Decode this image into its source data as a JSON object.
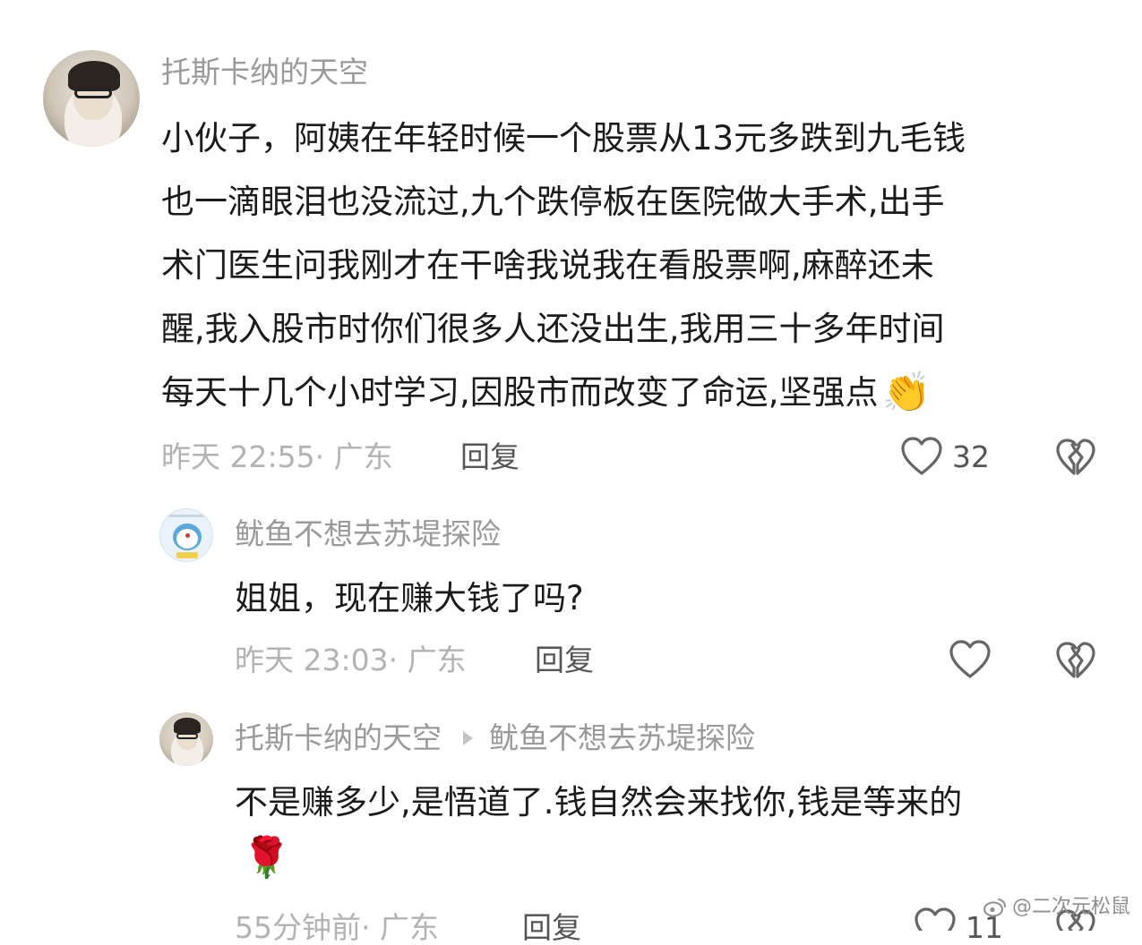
{
  "comments": [
    {
      "author": "托斯卡纳的天空",
      "lines": [
        "小伙子，阿姨在年轻时候一个股票从13元多跌到九毛钱",
        "也一滴眼泪也没流过,九个跌停板在医院做大手术,出手",
        "术门医生问我刚才在干啥我说我在看股票啊,麻醉还未",
        "醒,我入股市时你们很多人还没出生,我用三十多年时间",
        "每天十几个小时学习,因股市而改变了命运,坚强点"
      ],
      "emoji": "👏",
      "time": "昨天 22:55",
      "location": "广东",
      "reply_label": "回复",
      "likes": "32",
      "icons": {
        "like": "heart-icon",
        "dislike": "broken-heart-icon"
      }
    },
    {
      "author": "鱿鱼不想去苏堤探险",
      "text": "姐姐，现在赚大钱了吗?",
      "time": "昨天 23:03",
      "location": "广东",
      "reply_label": "回复",
      "likes": "",
      "icons": {
        "like": "heart-icon",
        "dislike": "broken-heart-icon"
      }
    },
    {
      "author": "托斯卡纳的天空",
      "reply_to": "鱿鱼不想去苏堤探险",
      "text": "不是赚多少,是悟道了.钱自然会来找你,钱是等来的",
      "emoji": "🌹",
      "time": "55分钟前",
      "location": "广东",
      "reply_label": "回复",
      "likes": "11",
      "icons": {
        "like": "heart-icon",
        "dislike": "broken-heart-icon"
      }
    }
  ],
  "watermark": "@二次元松鼠",
  "colors": {
    "meta": "#b3b3b3",
    "username": "#9a9a9a",
    "text": "#1b1b1b",
    "icon": "#666666"
  }
}
